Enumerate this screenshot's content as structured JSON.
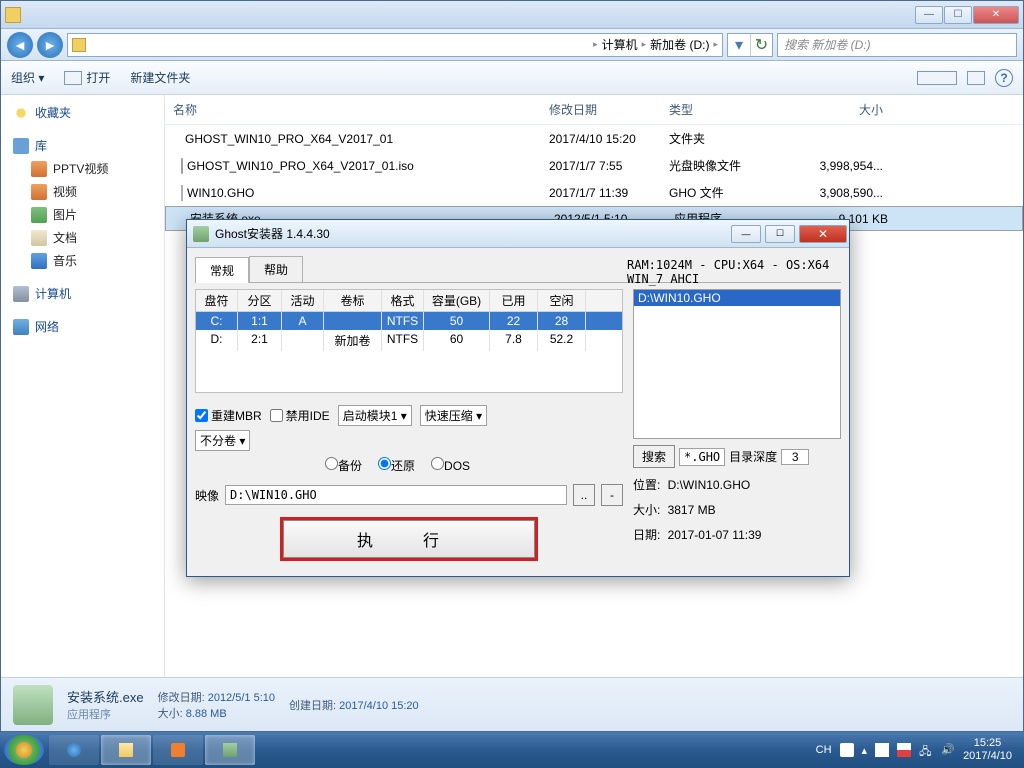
{
  "titlebar": {
    "min": "—",
    "max": "☐",
    "close": "✕"
  },
  "address": {
    "computer": "计算机",
    "drive": "新加卷 (D:)",
    "search_placeholder": "搜索 新加卷 (D:)"
  },
  "toolbar": {
    "organize": "组织 ▾",
    "open": "打开",
    "new_folder": "新建文件夹",
    "help": "?"
  },
  "sidebar": {
    "favorites": "收藏夹",
    "library": "库",
    "items": [
      "PPTV视频",
      "视频",
      "图片",
      "文档",
      "音乐"
    ],
    "computer": "计算机",
    "network": "网络"
  },
  "columns": {
    "name": "名称",
    "date": "修改日期",
    "type": "类型",
    "size": "大小"
  },
  "files": [
    {
      "icon": "fold",
      "name": "GHOST_WIN10_PRO_X64_V2017_01",
      "date": "2017/4/10 15:20",
      "type": "文件夹",
      "size": ""
    },
    {
      "icon": "iso",
      "name": "GHOST_WIN10_PRO_X64_V2017_01.iso",
      "date": "2017/1/7 7:55",
      "type": "光盘映像文件",
      "size": "3,998,954..."
    },
    {
      "icon": "gho",
      "name": "WIN10.GHO",
      "date": "2017/1/7 11:39",
      "type": "GHO 文件",
      "size": "3,908,590..."
    },
    {
      "icon": "exe",
      "name": "安装系统.exe",
      "date": "2012/5/1 5:10",
      "type": "应用程序",
      "size": "9,101 KB",
      "selected": true
    }
  ],
  "details": {
    "name": "安装系统.exe",
    "type": "应用程序",
    "mod_label": "修改日期:",
    "mod": "2012/5/1 5:10",
    "size_label": "大小:",
    "size": "8.88 MB",
    "create_label": "创建日期:",
    "create": "2017/4/10 15:20"
  },
  "dialog": {
    "title": "Ghost安装器 1.4.4.30",
    "tabs": {
      "general": "常规",
      "help": "帮助"
    },
    "sysinfo": "RAM:1024M - CPU:X64 - OS:X64 WIN_7 AHCI",
    "part_head": [
      "盘符",
      "分区",
      "活动",
      "卷标",
      "格式",
      "容量(GB)",
      "已用",
      "空闲"
    ],
    "parts": [
      {
        "d": "C:",
        "p": "1:1",
        "a": "A",
        "l": "",
        "f": "NTFS",
        "c": "50",
        "u": "22",
        "fr": "28",
        "sel": true
      },
      {
        "d": "D:",
        "p": "2:1",
        "a": "",
        "l": "新加卷",
        "f": "NTFS",
        "c": "60",
        "u": "7.8",
        "fr": "52.2"
      }
    ],
    "rebuild_mbr": "重建MBR",
    "disable_ide": "禁用IDE",
    "boot_module": "启动模块1 ▾",
    "compress": "快速压缩 ▾",
    "no_split": "不分卷 ▾",
    "backup": "备份",
    "restore": "还原",
    "dos": "DOS",
    "image_label": "映像",
    "image_path": "D:\\WIN10.GHO",
    "browse": "..",
    "clear": "-",
    "execute": "执行",
    "gho_list": "D:\\WIN10.GHO",
    "search": "搜索",
    "ext": "*.GHO",
    "depth_label": "目录深度",
    "depth": "3",
    "loc_label": "位置:",
    "loc": "D:\\WIN10.GHO",
    "sz_label": "大小:",
    "sz": "3817 MB",
    "dt_label": "日期:",
    "dt": "2017-01-07  11:39"
  },
  "taskbar": {
    "lang": "CH",
    "time": "15:25",
    "date": "2017/4/10"
  }
}
